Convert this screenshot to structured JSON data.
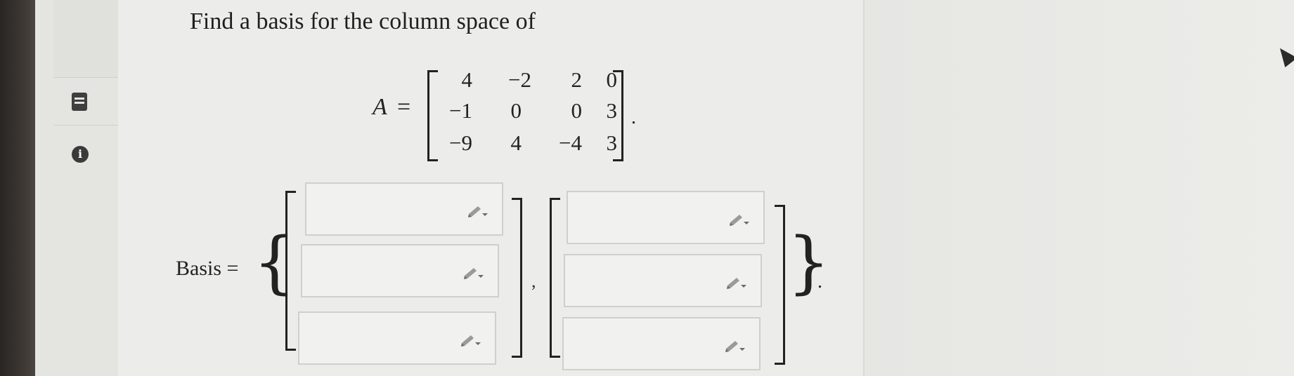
{
  "question": {
    "prompt": "Find a basis for the column space of",
    "matrix_label": "A",
    "equals": "=",
    "matrix": [
      [
        "4",
        "−2",
        "2",
        "0"
      ],
      [
        "−1",
        "0",
        "0",
        "3"
      ],
      [
        "−9",
        "4",
        "−4",
        "3"
      ]
    ],
    "trailing": "."
  },
  "answer": {
    "label": "Basis =",
    "open_brace": "{",
    "close_brace": "}",
    "separator": ",",
    "trailing": ".",
    "vectors": [
      {
        "entries": [
          {
            "value": ""
          },
          {
            "value": ""
          },
          {
            "value": ""
          }
        ]
      },
      {
        "entries": [
          {
            "value": ""
          },
          {
            "value": ""
          },
          {
            "value": ""
          }
        ]
      }
    ]
  },
  "icons": {
    "sidebar_top": "book-icon",
    "sidebar_bottom": "info-icon",
    "entry_tool": "pencil-icon",
    "pointer": "cursor-icon"
  },
  "colors": {
    "text": "#222222",
    "box_border": "#cfcfcc",
    "box_fill": "#f1f1ef"
  }
}
